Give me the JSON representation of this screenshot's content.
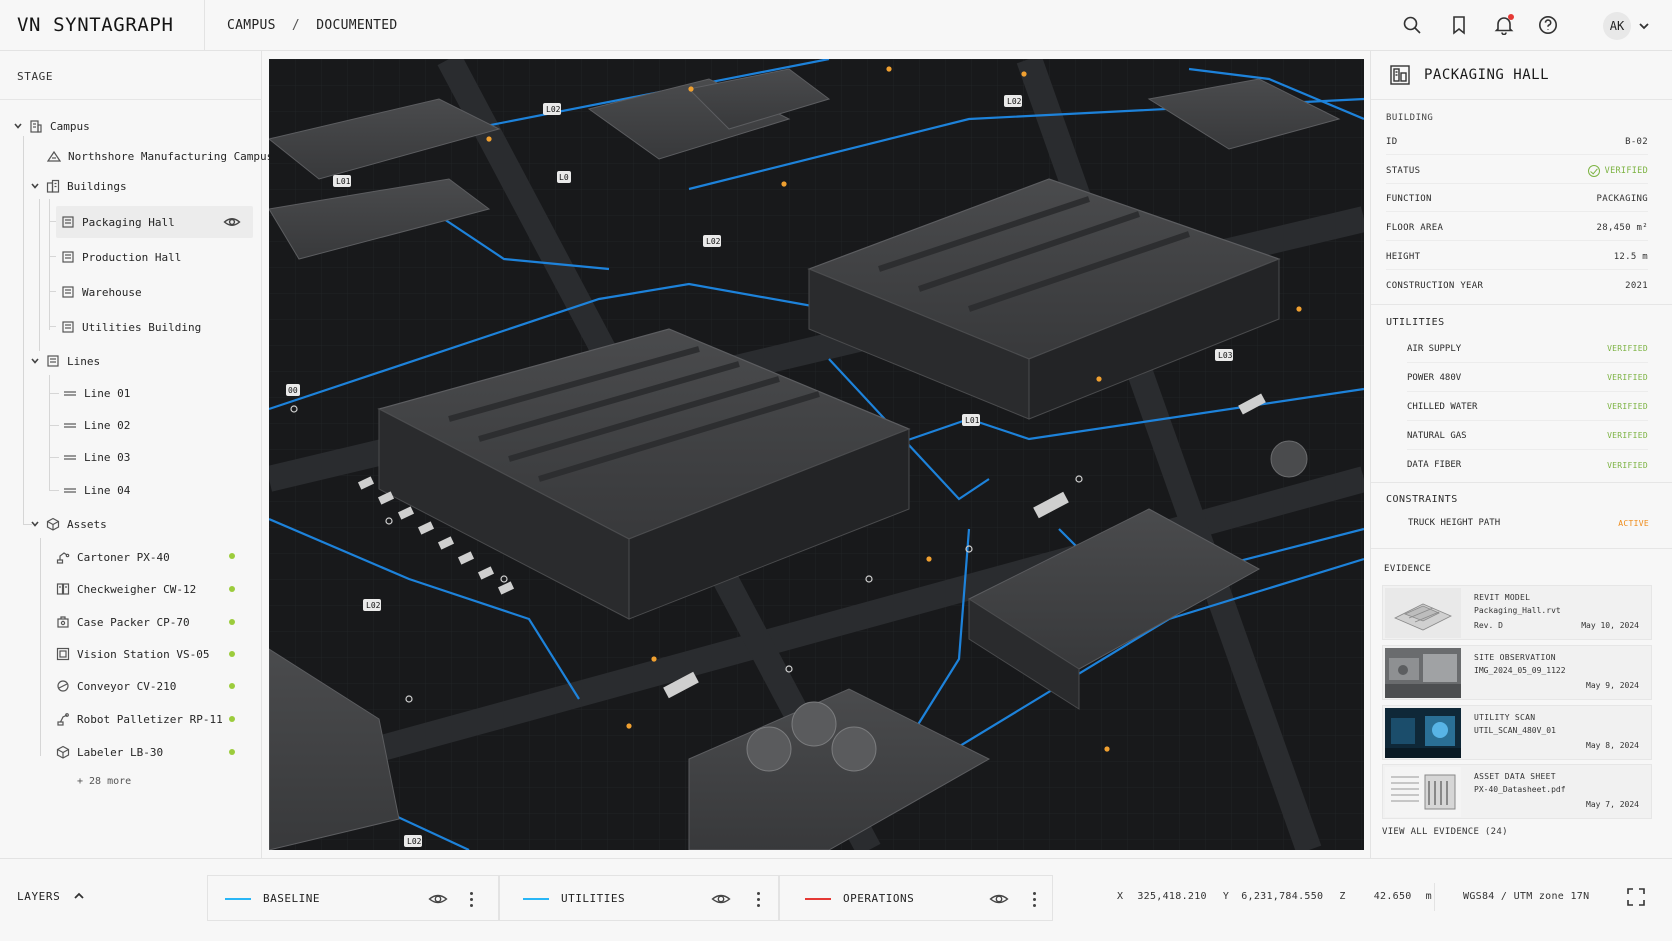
{
  "app": {
    "title": "VN SYNTAGRAPH",
    "breadcrumb": [
      "CAMPUS",
      "DOCUMENTED"
    ],
    "breadcrumb_sep": "/",
    "avatar_initials": "AK",
    "header_icons": [
      "search-icon",
      "bookmark-icon",
      "bell-icon",
      "help-icon"
    ],
    "notification_dot_color": "#e53935"
  },
  "stage": {
    "title": "STAGE",
    "tree": [
      {
        "label": "Campus",
        "icon": "building-icon",
        "level": 0,
        "expanded": true
      },
      {
        "label": "Northshore Manufacturing Campus",
        "icon": "campus-icon",
        "level": 1
      },
      {
        "label": "Buildings",
        "icon": "buildings-icon",
        "level": 1,
        "expanded": true
      },
      {
        "label": "Packaging Hall",
        "icon": "building-icon",
        "level": 2,
        "selected": true
      },
      {
        "label": "Production Hall",
        "icon": "building-icon",
        "level": 2
      },
      {
        "label": "Warehouse",
        "icon": "building-icon",
        "level": 2
      },
      {
        "label": "Utilities Building",
        "icon": "building-icon",
        "level": 2
      },
      {
        "label": "Lines",
        "icon": "lines-icon",
        "level": 1,
        "expanded": true
      },
      {
        "label": "Line 01",
        "icon": "line-icon",
        "level": 2
      },
      {
        "label": "Line 02",
        "icon": "line-icon",
        "level": 2
      },
      {
        "label": "Line 03",
        "icon": "line-icon",
        "level": 2
      },
      {
        "label": "Line 04",
        "icon": "line-icon",
        "level": 2
      },
      {
        "label": "Assets",
        "icon": "assets-icon",
        "level": 1,
        "expanded": true
      }
    ],
    "assets": [
      {
        "label": "Cartoner PX-40",
        "icon": "robot-arm-icon",
        "status_color": "#9ccc3c"
      },
      {
        "label": "Checkweigher CW-12",
        "icon": "scale-icon",
        "status_color": "#9ccc3c"
      },
      {
        "label": "Case Packer CP-70",
        "icon": "packer-icon",
        "status_color": "#9ccc3c"
      },
      {
        "label": "Vision Station VS-05",
        "icon": "camera-icon",
        "status_color": "#9ccc3c"
      },
      {
        "label": "Conveyor CV-210",
        "icon": "conveyor-icon",
        "status_color": "#9ccc3c"
      },
      {
        "label": "Robot Palletizer RP-11",
        "icon": "robot-icon",
        "status_color": "#9ccc3c"
      },
      {
        "label": "Labeler LB-30",
        "icon": "box-icon",
        "status_color": "#9ccc3c"
      }
    ],
    "more_label": "+ 28 more"
  },
  "map": {
    "labels": [
      "L01",
      "L02",
      "L0",
      "L02",
      "L02",
      "L03",
      "L01",
      "L02",
      "L02",
      "00"
    ],
    "route_color": "#1e88e5",
    "lamp_color": "#f0a030"
  },
  "detail": {
    "title": "PACKAGING HALL",
    "section_label": "BUILDING",
    "fields": [
      {
        "key": "ID",
        "value": "B-02"
      },
      {
        "key": "STATUS",
        "value": "VERIFIED"
      },
      {
        "key": "FUNCTION",
        "value": "PACKAGING"
      },
      {
        "key": "FLOOR AREA",
        "value": "28,450 m²"
      },
      {
        "key": "HEIGHT",
        "value": "12.5 m"
      },
      {
        "key": "CONSTRUCTION YEAR",
        "value": "2021"
      }
    ],
    "utilities_title": "UTILITIES",
    "utilities": [
      {
        "name": "AIR SUPPLY",
        "status": "VERIFIED"
      },
      {
        "name": "POWER 480V",
        "status": "VERIFIED"
      },
      {
        "name": "CHILLED WATER",
        "status": "VERIFIED"
      },
      {
        "name": "NATURAL GAS",
        "status": "VERIFIED"
      },
      {
        "name": "DATA FIBER",
        "status": "VERIFIED"
      }
    ],
    "constraints_title": "CONSTRAINTS",
    "constraints": [
      {
        "name": "TRUCK HEIGHT PATH",
        "status": "ACTIVE"
      }
    ],
    "evidence_title": "EVIDENCE",
    "evidence": [
      {
        "type": "REVIT MODEL",
        "file": "Packaging_Hall.rvt",
        "rev": "Rev. D",
        "date": "May 10, 2024"
      },
      {
        "type": "SITE OBSERVATION",
        "file": "IMG_2024_05_09_1122",
        "rev": "",
        "date": "May 9, 2024"
      },
      {
        "type": "UTILITY SCAN",
        "file": "UTIL_SCAN_480V_01",
        "rev": "",
        "date": "May 8, 2024"
      },
      {
        "type": "ASSET DATA SHEET",
        "file": "PX-40_Datasheet.pdf",
        "rev": "",
        "date": "May 7, 2024"
      }
    ],
    "view_all": "VIEW ALL EVIDENCE (24)",
    "verified_color": "#7cb342",
    "active_color": "#ef8c1a"
  },
  "bottom": {
    "layers_label": "LAYERS",
    "layers": [
      {
        "name": "BASELINE",
        "color": "#29b6f6"
      },
      {
        "name": "UTILITIES",
        "color": "#29b6f6"
      },
      {
        "name": "OPERATIONS",
        "color": "#e53935"
      }
    ],
    "coords": {
      "x_label": "X",
      "x": "325,418.210",
      "y_label": "Y",
      "y": "6,231,784.550",
      "z_label": "Z",
      "z": "42.650",
      "unit": "m"
    },
    "crs": "WGS84 / UTM zone 17N"
  }
}
